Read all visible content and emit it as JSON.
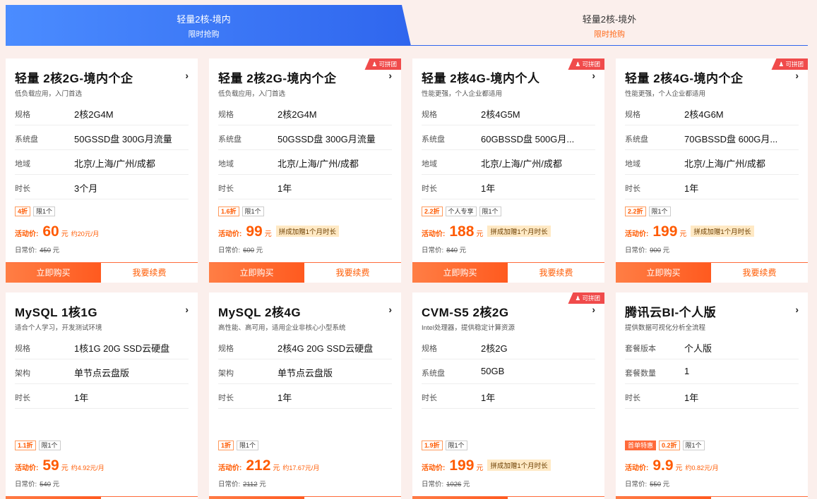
{
  "tabs": [
    {
      "title": "轻量2核-境内",
      "sub": "限时抢购"
    },
    {
      "title": "轻量2核-境外",
      "sub": "限时抢购"
    }
  ],
  "labels": {
    "activity_price": "活动价:",
    "regular_price": "日常价:",
    "yuan": "元",
    "buy": "立即购买",
    "renew": "我要续费",
    "group_badge": "可拼团",
    "chevron": "›"
  },
  "cards": [
    {
      "title": "轻量 2核2G-境内个企",
      "sub": "低负载应用，入门首选",
      "group": "",
      "specs": [
        {
          "k": "规格",
          "v": "2核2G4M"
        },
        {
          "k": "系统盘",
          "v": "50GSSD盘 300G月流量"
        },
        {
          "k": "地域",
          "v": "北京/上海/广州/成都"
        },
        {
          "k": "时长",
          "v": "3个月"
        }
      ],
      "tags": [
        {
          "t": "4折",
          "type": "disc"
        },
        {
          "t": "限1个",
          "type": ""
        }
      ],
      "price": "60",
      "note": "约20元/月",
      "promo": "",
      "orig": "450"
    },
    {
      "title": "轻量 2核2G-境内个企",
      "sub": "低负载应用，入门首选",
      "group": "可拼团",
      "specs": [
        {
          "k": "规格",
          "v": "2核2G4M"
        },
        {
          "k": "系统盘",
          "v": "50GSSD盘 300G月流量"
        },
        {
          "k": "地域",
          "v": "北京/上海/广州/成都"
        },
        {
          "k": "时长",
          "v": "1年"
        }
      ],
      "tags": [
        {
          "t": "1.6折",
          "type": "disc"
        },
        {
          "t": "限1个",
          "type": ""
        }
      ],
      "price": "99",
      "note": "",
      "promo": "拼成加赠1个月时长",
      "orig": "600"
    },
    {
      "title": "轻量 2核4G-境内个人",
      "sub": "性能更强，个人企业都适用",
      "group": "可拼团",
      "specs": [
        {
          "k": "规格",
          "v": "2核4G5M"
        },
        {
          "k": "系统盘",
          "v": "60GBSSD盘 500G月..."
        },
        {
          "k": "地域",
          "v": "北京/上海/广州/成都"
        },
        {
          "k": "时长",
          "v": "1年"
        }
      ],
      "tags": [
        {
          "t": "2.2折",
          "type": "disc"
        },
        {
          "t": "个人专享",
          "type": ""
        },
        {
          "t": "限1个",
          "type": ""
        }
      ],
      "price": "188",
      "note": "",
      "promo": "拼成加赠1个月时长",
      "orig": "840"
    },
    {
      "title": "轻量 2核4G-境内个企",
      "sub": "性能更强，个人企业都适用",
      "group": "可拼团",
      "specs": [
        {
          "k": "规格",
          "v": "2核4G6M"
        },
        {
          "k": "系统盘",
          "v": "70GBSSD盘 600G月..."
        },
        {
          "k": "地域",
          "v": "北京/上海/广州/成都"
        },
        {
          "k": "时长",
          "v": "1年"
        }
      ],
      "tags": [
        {
          "t": "2.2折",
          "type": "disc"
        },
        {
          "t": "限1个",
          "type": ""
        }
      ],
      "price": "199",
      "note": "",
      "promo": "拼成加赠1个月时长",
      "orig": "900"
    },
    {
      "title": "MySQL 1核1G",
      "sub": "适合个人学习，开发测试环境",
      "group": "",
      "specs": [
        {
          "k": "规格",
          "v": "1核1G 20G SSD云硬盘"
        },
        {
          "k": "架构",
          "v": "单节点云盘版"
        },
        {
          "k": "时长",
          "v": "1年"
        }
      ],
      "tags": [
        {
          "t": "1.1折",
          "type": "disc"
        },
        {
          "t": "限1个",
          "type": ""
        }
      ],
      "price": "59",
      "note": "约4.92元/月",
      "promo": "",
      "orig": "540"
    },
    {
      "title": "MySQL 2核4G",
      "sub": "高性能、高可用，适用企业非核心小型系统",
      "group": "",
      "specs": [
        {
          "k": "规格",
          "v": "2核4G 20G SSD云硬盘"
        },
        {
          "k": "架构",
          "v": "单节点云盘版"
        },
        {
          "k": "时长",
          "v": "1年"
        }
      ],
      "tags": [
        {
          "t": "1折",
          "type": "disc"
        },
        {
          "t": "限1个",
          "type": ""
        }
      ],
      "price": "212",
      "note": "约17.67元/月",
      "promo": "",
      "orig": "2112"
    },
    {
      "title": "CVM-S5 2核2G",
      "sub": "Intel处理器，提供稳定计算资源",
      "group": "可拼团",
      "specs": [
        {
          "k": "规格",
          "v": "2核2G"
        },
        {
          "k": "系统盘",
          "v": "50GB"
        },
        {
          "k": "时长",
          "v": "1年"
        }
      ],
      "tags": [
        {
          "t": "1.9折",
          "type": "disc"
        },
        {
          "t": "限1个",
          "type": ""
        }
      ],
      "price": "199",
      "note": "",
      "promo": "拼成加赠1个月时长",
      "orig": "1026"
    },
    {
      "title": "腾讯云BI-个人版",
      "sub": "提供数据可视化分析全流程",
      "group": "",
      "specs": [
        {
          "k": "套餐版本",
          "v": "个人版"
        },
        {
          "k": "套餐数量",
          "v": "1"
        },
        {
          "k": "时长",
          "v": "1年"
        }
      ],
      "tags": [
        {
          "t": "首单特惠",
          "type": "first"
        },
        {
          "t": "0.2折",
          "type": "disc"
        },
        {
          "t": "限1个",
          "type": ""
        }
      ],
      "price": "9.9",
      "note": "约0.82元/月",
      "promo": "",
      "orig": "550"
    }
  ]
}
